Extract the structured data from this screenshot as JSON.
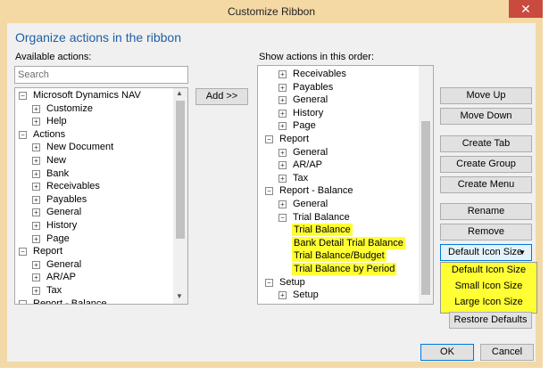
{
  "window": {
    "title": "Customize Ribbon",
    "close_glyph": "✕"
  },
  "heading": "Organize actions in the ribbon",
  "available_label": "Available actions:",
  "search_placeholder": "Search",
  "add_label": "Add >>",
  "order_label": "Show actions in this order:",
  "left_tree": [
    {
      "label": "Microsoft Dynamics NAV",
      "level": 0,
      "toggle": "minus"
    },
    {
      "label": "Customize",
      "level": 1,
      "toggle": "plus"
    },
    {
      "label": "Help",
      "level": 1,
      "toggle": "plus"
    },
    {
      "label": "Actions",
      "level": 0,
      "toggle": "minus"
    },
    {
      "label": "New Document",
      "level": 1,
      "toggle": "plus"
    },
    {
      "label": "New",
      "level": 1,
      "toggle": "plus"
    },
    {
      "label": "Bank",
      "level": 1,
      "toggle": "plus"
    },
    {
      "label": "Receivables",
      "level": 1,
      "toggle": "plus"
    },
    {
      "label": "Payables",
      "level": 1,
      "toggle": "plus"
    },
    {
      "label": "General",
      "level": 1,
      "toggle": "plus"
    },
    {
      "label": "History",
      "level": 1,
      "toggle": "plus"
    },
    {
      "label": "Page",
      "level": 1,
      "toggle": "plus"
    },
    {
      "label": "Report",
      "level": 0,
      "toggle": "minus"
    },
    {
      "label": "General",
      "level": 1,
      "toggle": "plus"
    },
    {
      "label": "AR/AP",
      "level": 1,
      "toggle": "plus"
    },
    {
      "label": "Tax",
      "level": 1,
      "toggle": "plus"
    },
    {
      "label": "Report - Balance",
      "level": 0,
      "toggle": "minus"
    }
  ],
  "right_tree": [
    {
      "label": "Receivables",
      "level": 1,
      "toggle": "plus",
      "hl": false
    },
    {
      "label": "Payables",
      "level": 1,
      "toggle": "plus",
      "hl": false
    },
    {
      "label": "General",
      "level": 1,
      "toggle": "plus",
      "hl": false
    },
    {
      "label": "History",
      "level": 1,
      "toggle": "plus",
      "hl": false
    },
    {
      "label": "Page",
      "level": 1,
      "toggle": "plus",
      "hl": false
    },
    {
      "label": "Report",
      "level": 0,
      "toggle": "minus",
      "hl": false
    },
    {
      "label": "General",
      "level": 1,
      "toggle": "plus",
      "hl": false
    },
    {
      "label": "AR/AP",
      "level": 1,
      "toggle": "plus",
      "hl": false
    },
    {
      "label": "Tax",
      "level": 1,
      "toggle": "plus",
      "hl": false
    },
    {
      "label": "Report - Balance",
      "level": 0,
      "toggle": "minus",
      "hl": false
    },
    {
      "label": "General",
      "level": 1,
      "toggle": "plus",
      "hl": false
    },
    {
      "label": "Trial Balance",
      "level": 1,
      "toggle": "minus",
      "hl": false
    },
    {
      "label": "Trial Balance",
      "level": 2,
      "toggle": "",
      "hl": true
    },
    {
      "label": "Bank Detail Trial Balance",
      "level": 2,
      "toggle": "",
      "hl": true
    },
    {
      "label": "Trial Balance/Budget",
      "level": 2,
      "toggle": "",
      "hl": true
    },
    {
      "label": "Trial Balance by Period",
      "level": 2,
      "toggle": "",
      "hl": true
    },
    {
      "label": "Setup",
      "level": 0,
      "toggle": "minus",
      "hl": false
    },
    {
      "label": "Setup",
      "level": 1,
      "toggle": "plus",
      "hl": false
    }
  ],
  "buttons": {
    "move_up": "Move Up",
    "move_down": "Move Down",
    "create_tab": "Create Tab",
    "create_group": "Create Group",
    "create_menu": "Create Menu",
    "rename": "Rename",
    "remove": "Remove",
    "icon_size": "Default Icon Size",
    "restore": "Restore Defaults",
    "ok": "OK",
    "cancel": "Cancel"
  },
  "icon_size_options": [
    "Default Icon Size",
    "Small Icon Size",
    "Large Icon Size"
  ],
  "colors": {
    "highlight": "#ffff33",
    "heading": "#1f5fa5",
    "titlebar": "#f5d9a5",
    "close": "#c94a3f"
  }
}
